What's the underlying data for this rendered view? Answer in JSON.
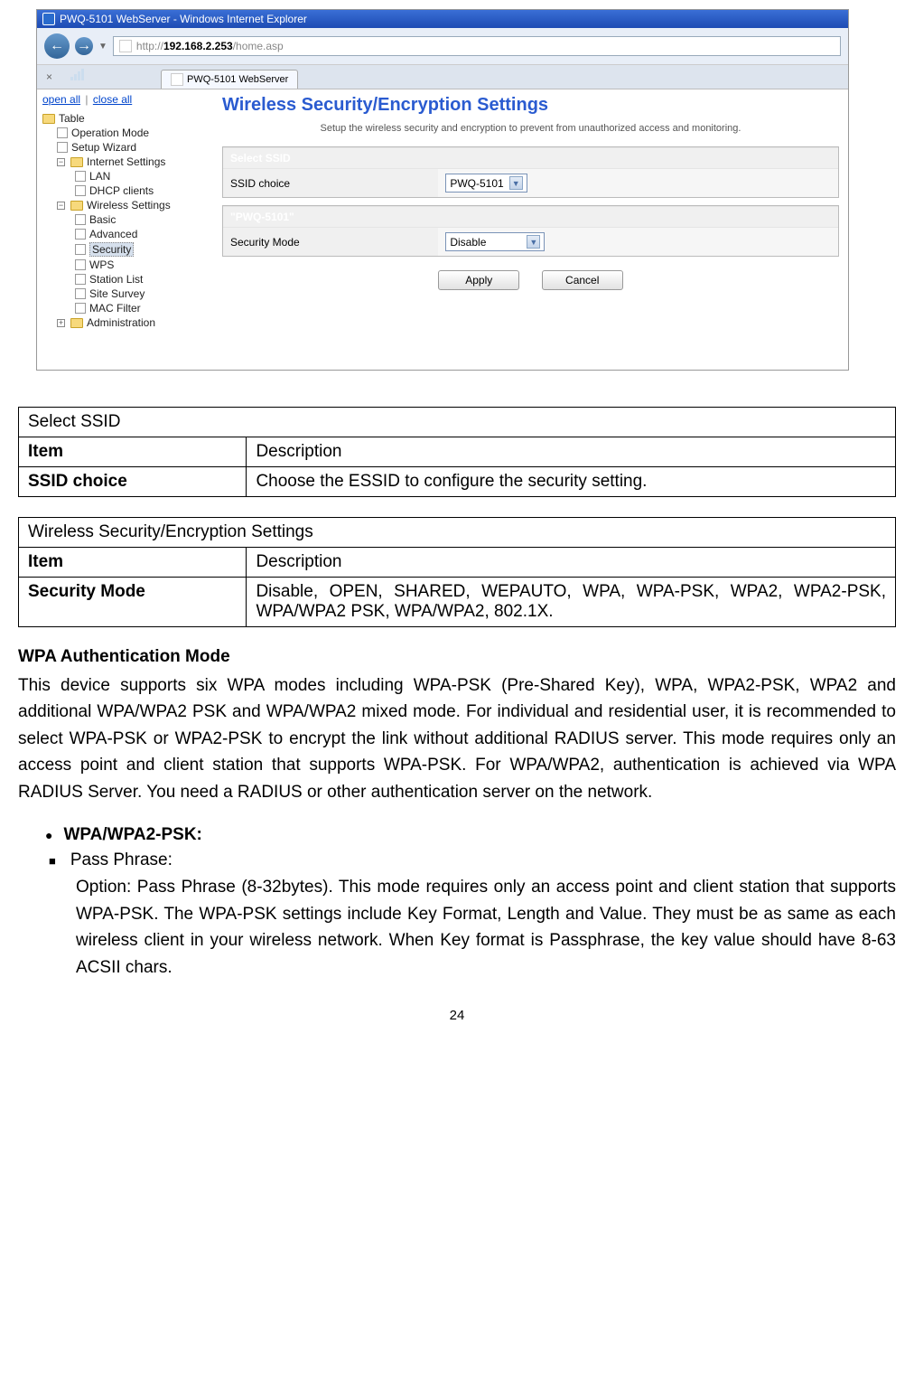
{
  "browser": {
    "window_title": "PWQ-5101 WebServer - Windows Internet Explorer",
    "url_prefix": "http://",
    "url_host": "192.168.2.253",
    "url_path": "/home.asp",
    "tab_title": "PWQ-5101 WebServer",
    "close_x": "×"
  },
  "sidebar": {
    "open_all": "open all",
    "close_all": "close all",
    "root": "Table",
    "items": [
      "Operation Mode",
      "Setup Wizard"
    ],
    "internet": {
      "label": "Internet Settings",
      "children": [
        "LAN",
        "DHCP clients"
      ]
    },
    "wireless": {
      "label": "Wireless Settings",
      "children": [
        "Basic",
        "Advanced",
        "Security",
        "WPS",
        "Station List",
        "Site Survey",
        "MAC Filter"
      ]
    },
    "admin": "Administration"
  },
  "panel": {
    "title": "Wireless Security/Encryption Settings",
    "subtitle": "Setup the wireless security and encryption to prevent from unauthorized access and monitoring.",
    "select_ssid_header": "Select SSID",
    "ssid_choice_label": "SSID choice",
    "ssid_value": "PWQ-5101",
    "ssid_section_label": "\"PWQ-5101\"",
    "sec_mode_label": "Security Mode",
    "sec_mode_value": "Disable",
    "apply": "Apply",
    "cancel": "Cancel"
  },
  "table1": {
    "title": "Select SSID",
    "h1": "Item",
    "h2": "Description",
    "r1c1": "SSID choice",
    "r1c2": "Choose the ESSID to configure the security setting."
  },
  "table2": {
    "title": "Wireless Security/Encryption Settings",
    "h1": "Item",
    "h2": "Description",
    "r1c1": "Security Mode",
    "r1c2": "Disable, OPEN, SHARED, WEPAUTO, WPA, WPA-PSK, WPA2, WPA2-PSK, WPA/WPA2 PSK, WPA/WPA2, 802.1X."
  },
  "text": {
    "heading": "WPA Authentication Mode",
    "para": "This device supports six WPA modes including WPA-PSK (Pre-Shared Key), WPA, WPA2-PSK, WPA2 and additional WPA/WPA2 PSK and WPA/WPA2 mixed mode. For individual and residential user, it is recommended to select WPA-PSK or WPA2-PSK to encrypt the link without additional RADIUS server. This mode requires only an access point and client station that supports WPA-PSK. For WPA/WPA2, authentication is achieved via WPA RADIUS Server. You need a RADIUS or other authentication server on the network.",
    "bullet1": "WPA/WPA2-PSK:",
    "bullet2": "Pass Phrase:",
    "sub": "Option: Pass Phrase (8-32bytes). This mode requires only an access point and client station that supports WPA-PSK. The WPA-PSK settings include Key Format, Length and Value. They must be as same as each wireless client in your wireless network. When Key format is Passphrase, the key value should have 8-63 ACSII chars.",
    "page_num": "24"
  }
}
